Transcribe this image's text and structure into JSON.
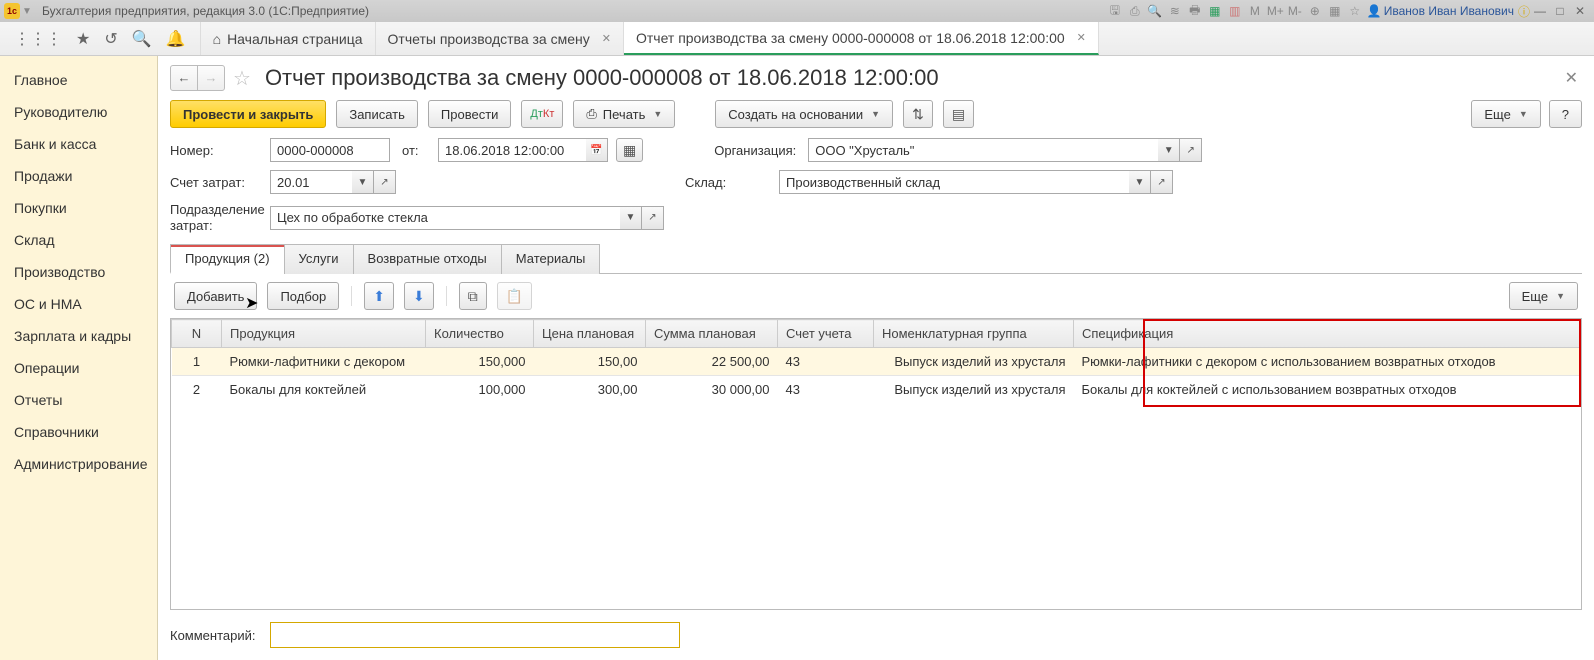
{
  "titlebar": {
    "title": "Бухгалтерия предприятия, редакция 3.0  (1С:Предприятие)",
    "user": "Иванов Иван Иванович"
  },
  "toptabs": {
    "home": "Начальная страница",
    "tab1": "Отчеты производства за смену",
    "tab2": "Отчет производства за смену 0000-000008 от 18.06.2018 12:00:00"
  },
  "sidebar": {
    "items": [
      "Главное",
      "Руководителю",
      "Банк и касса",
      "Продажи",
      "Покупки",
      "Склад",
      "Производство",
      "ОС и НМА",
      "Зарплата и кадры",
      "Операции",
      "Отчеты",
      "Справочники",
      "Администрирование"
    ]
  },
  "page": {
    "title": "Отчет производства за смену 0000-000008 от 18.06.2018 12:00:00"
  },
  "toolbar": {
    "post_close": "Провести и закрыть",
    "write": "Записать",
    "post": "Провести",
    "print": "Печать",
    "create_based": "Создать на основании",
    "more": "Еще",
    "help": "?"
  },
  "form": {
    "number_lbl": "Номер:",
    "number": "0000-000008",
    "date_lbl": "от:",
    "date": "18.06.2018 12:00:00",
    "org_lbl": "Организация:",
    "org": "ООО \"Хрусталь\"",
    "acct_lbl": "Счет затрат:",
    "acct": "20.01",
    "wh_lbl": "Склад:",
    "wh": "Производственный склад",
    "dept_lbl": "Подразделение затрат:",
    "dept": "Цех по обработке стекла",
    "comment_lbl": "Комментарий:",
    "comment": ""
  },
  "subtabs": {
    "t1": "Продукция (2)",
    "t2": "Услуги",
    "t3": "Возвратные отходы",
    "t4": "Материалы"
  },
  "tablebar": {
    "add": "Добавить",
    "pick": "Подбор",
    "more": "Еще"
  },
  "table": {
    "cols": [
      "N",
      "Продукция",
      "Количество",
      "Цена плановая",
      "Сумма плановая",
      "Счет учета",
      "Номенклатурная группа",
      "Спецификация"
    ],
    "rows": [
      {
        "n": "1",
        "prod": "Рюмки-лафитники с декором",
        "qty": "150,000",
        "price": "150,00",
        "sum": "22 500,00",
        "acct": "43",
        "group": "Выпуск изделий из хрусталя",
        "spec": "Рюмки-лафитники с декором с использованием возвратных отходов"
      },
      {
        "n": "2",
        "prod": "Бокалы для коктейлей",
        "qty": "100,000",
        "price": "300,00",
        "sum": "30 000,00",
        "acct": "43",
        "group": "Выпуск изделий из хрусталя",
        "spec": "Бокалы для коктейлей с использованием возвратных отходов"
      }
    ]
  }
}
